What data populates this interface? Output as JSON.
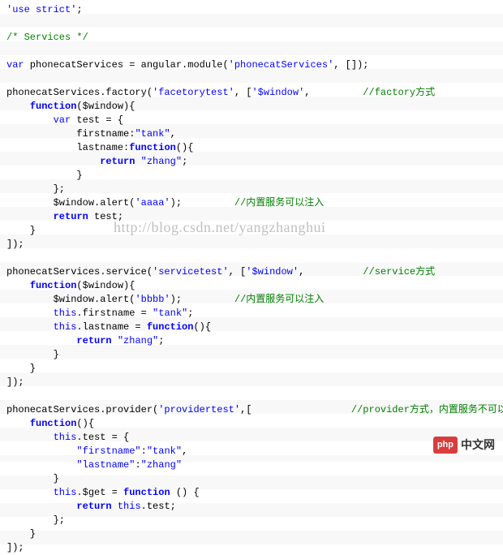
{
  "code": {
    "l1": "'use strict'",
    "l3": "/* Services */",
    "l5a": "var",
    "l5b": " phonecatServices = angular.module(",
    "l5c": "'phonecatServices'",
    "l5d": ", []);",
    "l7a": "phonecatServices.factory(",
    "l7b": "'facetorytest'",
    "l7c": ", [",
    "l7d": "'$window'",
    "l7e": ",         ",
    "l7f": "//factory方式",
    "l8a": "    ",
    "l8b": "function",
    "l8c": "($window){",
    "l9a": "        ",
    "l9b": "var",
    "l9c": " test = {",
    "l10": "            firstname:",
    "l10b": "\"tank\"",
    "l10c": ",",
    "l11a": "            lastname:",
    "l11b": "function",
    "l11c": "(){",
    "l12a": "                ",
    "l12b": "return",
    "l12c": " ",
    "l12d": "\"zhang\"",
    "l12e": ";",
    "l13": "            }",
    "l14": "        };",
    "l15a": "        $window.alert(",
    "l15b": "'aaaa'",
    "l15c": ");         ",
    "l15d": "//内置服务可以注入",
    "l16a": "        ",
    "l16b": "return",
    "l16c": " test;",
    "l17": "    }",
    "l18": "]);",
    "l20a": "phonecatServices.service(",
    "l20b": "'servicetest'",
    "l20c": ", [",
    "l20d": "'$window'",
    "l20e": ",          ",
    "l20f": "//service方式",
    "l21a": "    ",
    "l21b": "function",
    "l21c": "($window){",
    "l22a": "        $window.alert(",
    "l22b": "'bbbb'",
    "l22c": ");         ",
    "l22d": "//内置服务可以注入",
    "l23a": "        ",
    "l23b": "this",
    "l23c": ".firstname = ",
    "l23d": "\"tank\"",
    "l23e": ";",
    "l24a": "        ",
    "l24b": "this",
    "l24c": ".lastname = ",
    "l24d": "function",
    "l24e": "(){",
    "l25a": "            ",
    "l25b": "return",
    "l25c": " ",
    "l25d": "\"zhang\"",
    "l25e": ";",
    "l26": "        }",
    "l27": "    }",
    "l28": "]);",
    "l30a": "phonecatServices.provider(",
    "l30b": "'providertest'",
    "l30c": ",[                 ",
    "l30d": "//provider方式，内置服务不可以注入",
    "l31a": "    ",
    "l31b": "function",
    "l31c": "(){",
    "l32a": "        ",
    "l32b": "this",
    "l32c": ".test = {",
    "l33a": "            ",
    "l33b": "\"firstname\"",
    "l33c": ":",
    "l33d": "\"tank\"",
    "l33e": ",",
    "l34a": "            ",
    "l34b": "\"lastname\"",
    "l34c": ":",
    "l34d": "\"zhang\"",
    "l35": "        }",
    "l36a": "        ",
    "l36b": "this",
    "l36c": ".$get = ",
    "l36d": "function",
    "l36e": " () {",
    "l37a": "            ",
    "l37b": "return",
    "l37c": " ",
    "l37d": "this",
    "l37e": ".test;",
    "l38": "        };",
    "l39": "    }",
    "l40": "]);"
  },
  "watermark": "http://blog.csdn.net/yangzhanghui",
  "logo": {
    "badge": "php",
    "text": "中文网"
  }
}
